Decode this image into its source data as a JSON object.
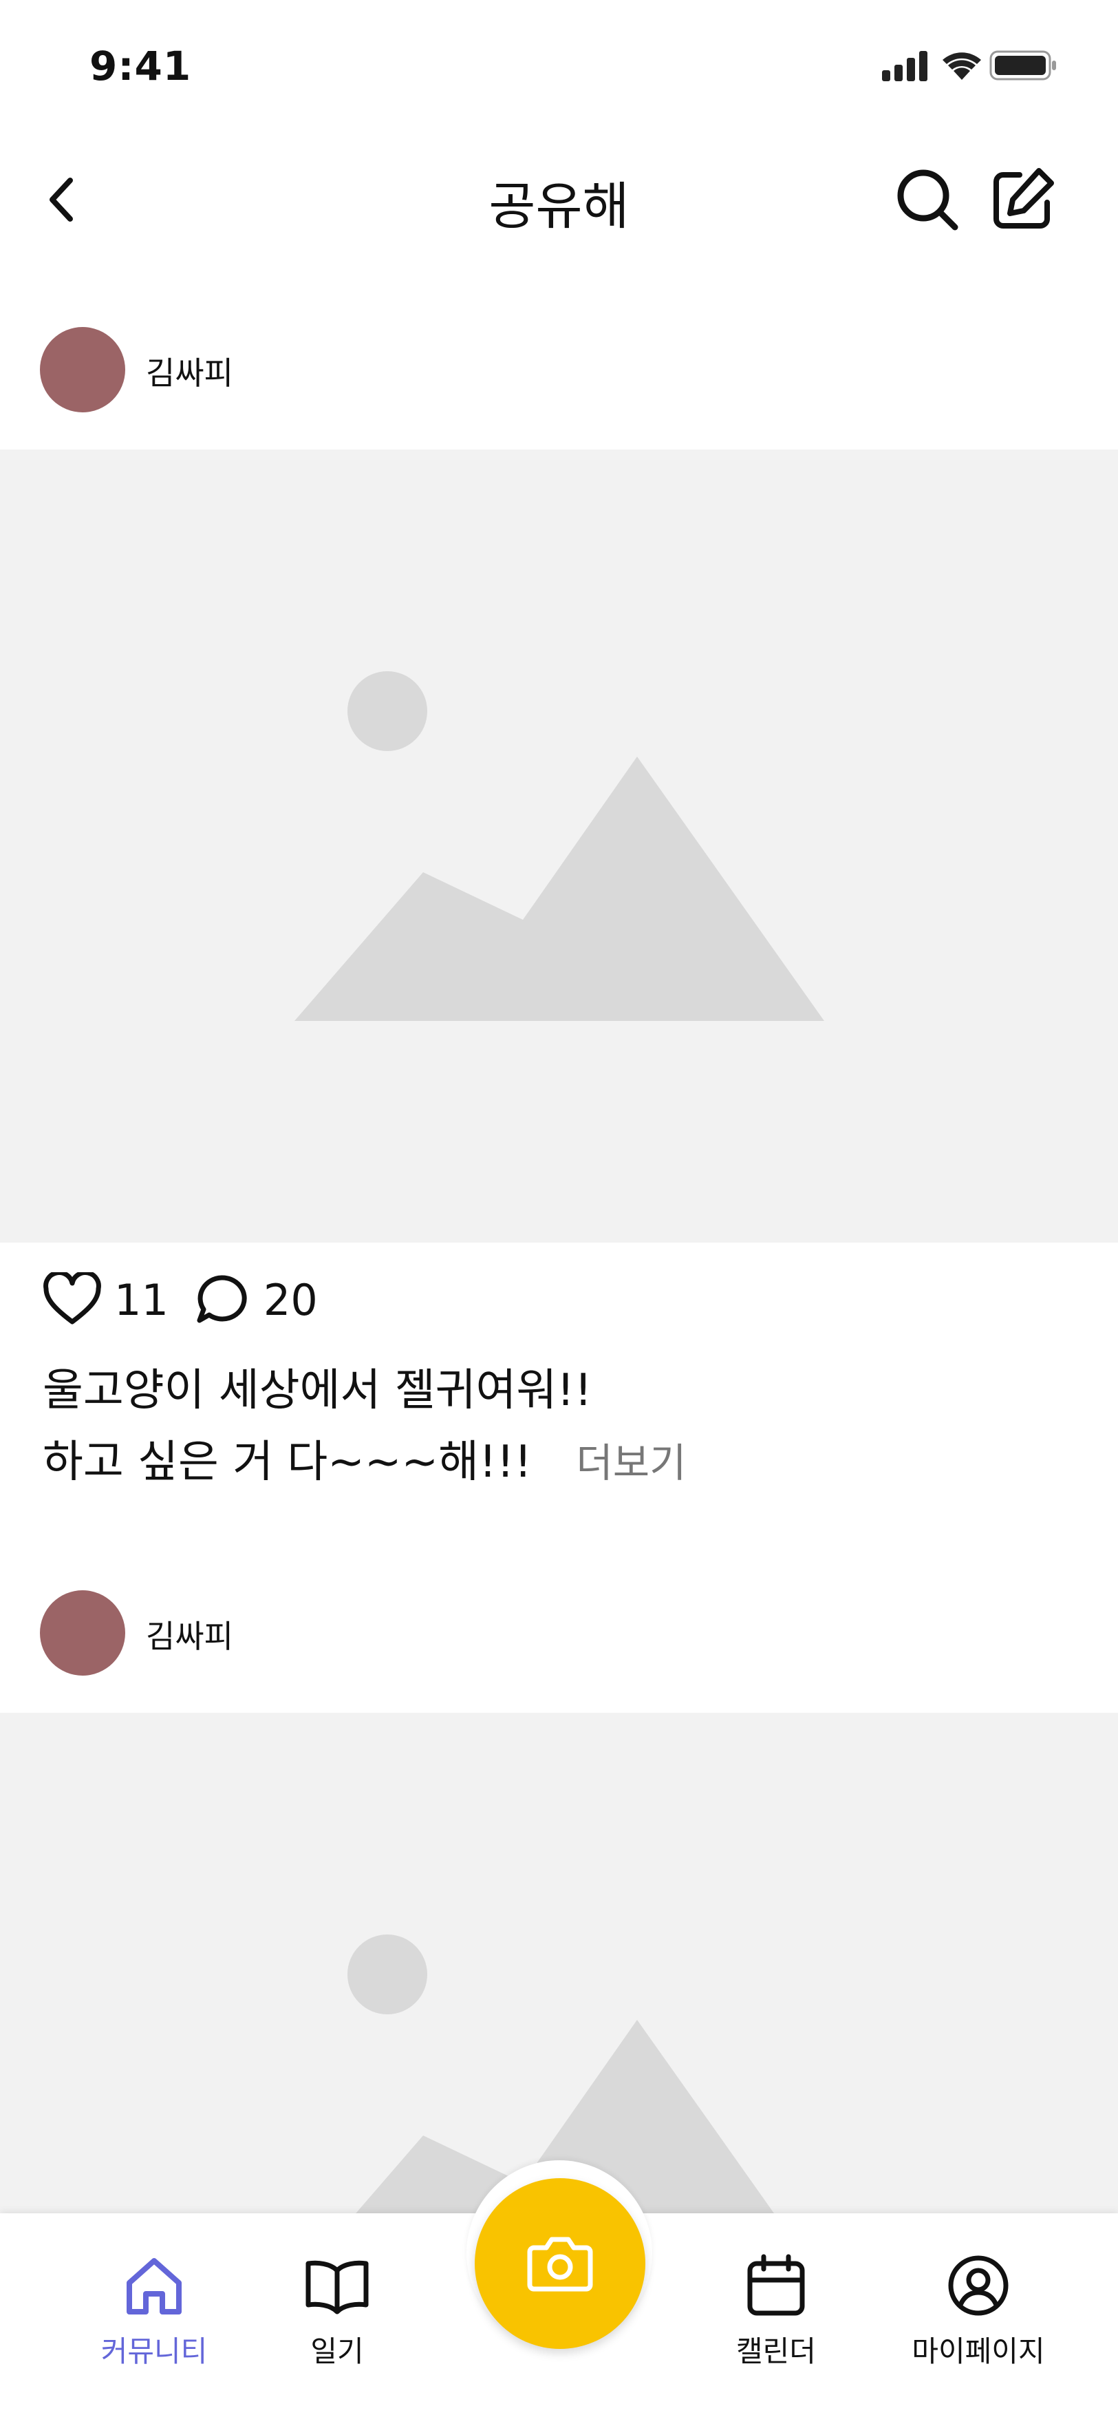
{
  "status_bar": {
    "time": "9:41"
  },
  "header": {
    "title": "공유해"
  },
  "posts": [
    {
      "username": "김싸피",
      "likes": "11",
      "comments": "20",
      "caption_line1": "울고양이 세상에서 젤귀여워!!",
      "caption_line2": "하고 싶은 거 다~~~해!!!",
      "more_label": "더보기"
    },
    {
      "username": "김싸피"
    }
  ],
  "bottom_nav": {
    "items": [
      {
        "label": "커뮤니티",
        "icon": "home-icon",
        "active": true
      },
      {
        "label": "일기",
        "icon": "book-icon",
        "active": false
      },
      {
        "label": "캘린더",
        "icon": "calendar-icon",
        "active": false
      },
      {
        "label": "마이페이지",
        "icon": "user-circle-icon",
        "active": false
      }
    ],
    "camera_icon": "camera-icon"
  },
  "colors": {
    "accent": "#6366d9",
    "camera_button": "#f9c300",
    "avatar": "#9b6466",
    "image_placeholder_bg": "#f2f2f2",
    "image_placeholder_shape": "#d9d9d9"
  }
}
